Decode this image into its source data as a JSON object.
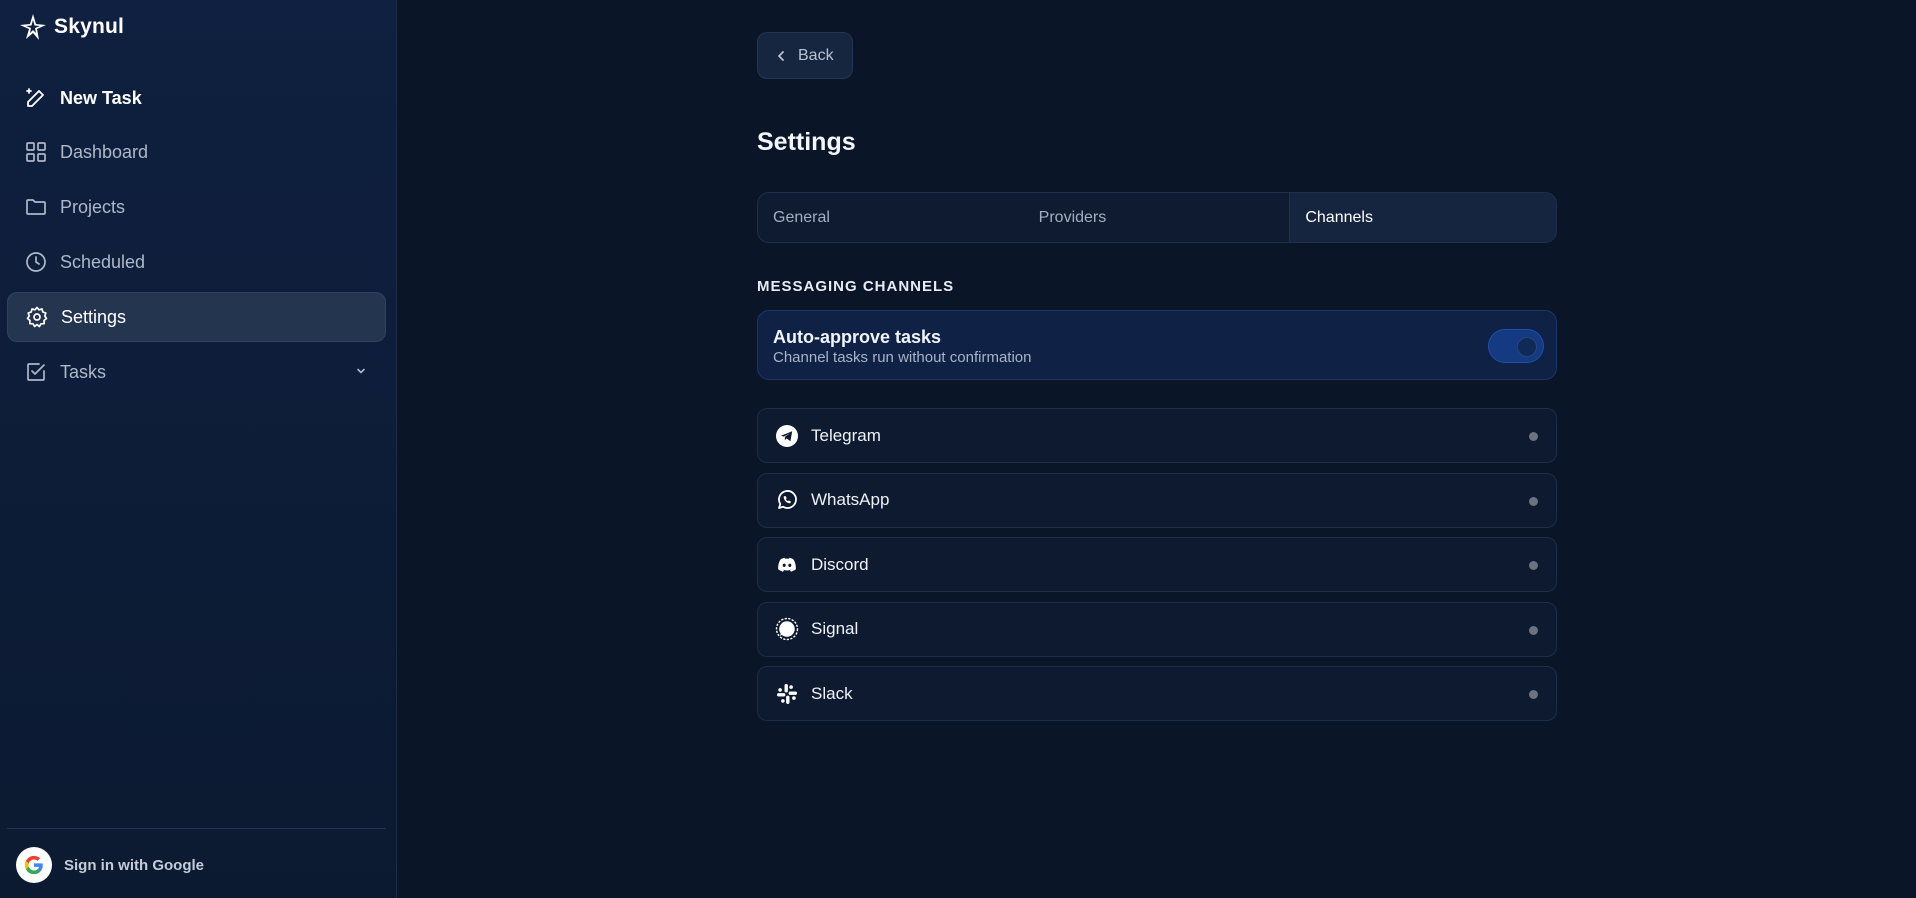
{
  "brand": {
    "name": "Skynul"
  },
  "sidebar": {
    "items": [
      {
        "label": "New Task",
        "icon": "pen-sparkle-icon"
      },
      {
        "label": "Dashboard",
        "icon": "grid-icon"
      },
      {
        "label": "Projects",
        "icon": "folder-icon"
      },
      {
        "label": "Scheduled",
        "icon": "clock-icon"
      },
      {
        "label": "Settings",
        "icon": "gear-icon",
        "active": true
      },
      {
        "label": "Tasks",
        "icon": "checkbox-icon"
      }
    ],
    "signin_label": "Sign in with Google"
  },
  "header": {
    "back_label": "Back",
    "title": "Settings"
  },
  "tabs": [
    {
      "label": "General"
    },
    {
      "label": "Providers"
    },
    {
      "label": "Channels",
      "active": true
    }
  ],
  "section": {
    "label": "MESSAGING CHANNELS"
  },
  "auto_approve": {
    "title": "Auto-approve tasks",
    "subtitle": "Channel tasks run without confirmation",
    "enabled": true
  },
  "channels": [
    {
      "name": "Telegram",
      "icon": "telegram-icon"
    },
    {
      "name": "WhatsApp",
      "icon": "whatsapp-icon"
    },
    {
      "name": "Discord",
      "icon": "discord-icon"
    },
    {
      "name": "Signal",
      "icon": "signal-icon"
    },
    {
      "name": "Slack",
      "icon": "slack-icon"
    }
  ],
  "colors": {
    "background": "#0b1528",
    "sidebar": "#0f2040",
    "accent": "#143a82",
    "status_dot": "#6b7280"
  }
}
